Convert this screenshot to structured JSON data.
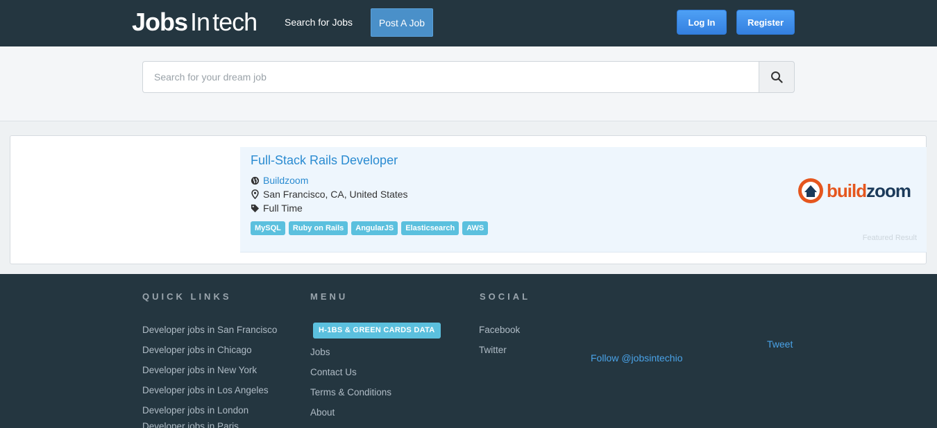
{
  "header": {
    "logo_main": "Jobs",
    "logo_second": "In",
    "logo_third": "tech",
    "search_jobs": "Search for Jobs",
    "post_job": "Post A Job",
    "login": "Log In",
    "register": "Register"
  },
  "search": {
    "placeholder": "Search for your dream job"
  },
  "job": {
    "title": "Full-Stack Rails Developer",
    "company": "Buildzoom",
    "location": "San Francisco, CA, United States",
    "type": "Full Time",
    "tags": [
      "MySQL",
      "Ruby on Rails",
      "AngularJS",
      "Elasticsearch",
      "AWS"
    ],
    "logo_build": "build",
    "logo_zoom": "zoom",
    "featured": "Featured Result"
  },
  "footer": {
    "quick_links_heading": "QUICK LINKS",
    "quick_links": [
      "Developer jobs in San Francisco",
      "Developer jobs in Chicago",
      "Developer jobs in New York",
      "Developer jobs in Los Angeles",
      "Developer jobs in London",
      "Developer jobs in Paris"
    ],
    "menu_heading": "MENU",
    "menu_badge": "H-1BS & GREEN CARDS DATA",
    "menu_items": [
      "Jobs",
      "Contact Us",
      "Terms & Conditions",
      "About"
    ],
    "social_heading": "SOCIAL",
    "social_items": [
      "Facebook",
      "Twitter"
    ],
    "follow": "Follow @jobsintechio",
    "tweet": "Tweet"
  },
  "colors": {
    "header_bg": "#243640",
    "accent_blue": "#2a8bd1",
    "tag_bg": "#5bc0de",
    "button_blue": "#3d8ee8"
  }
}
